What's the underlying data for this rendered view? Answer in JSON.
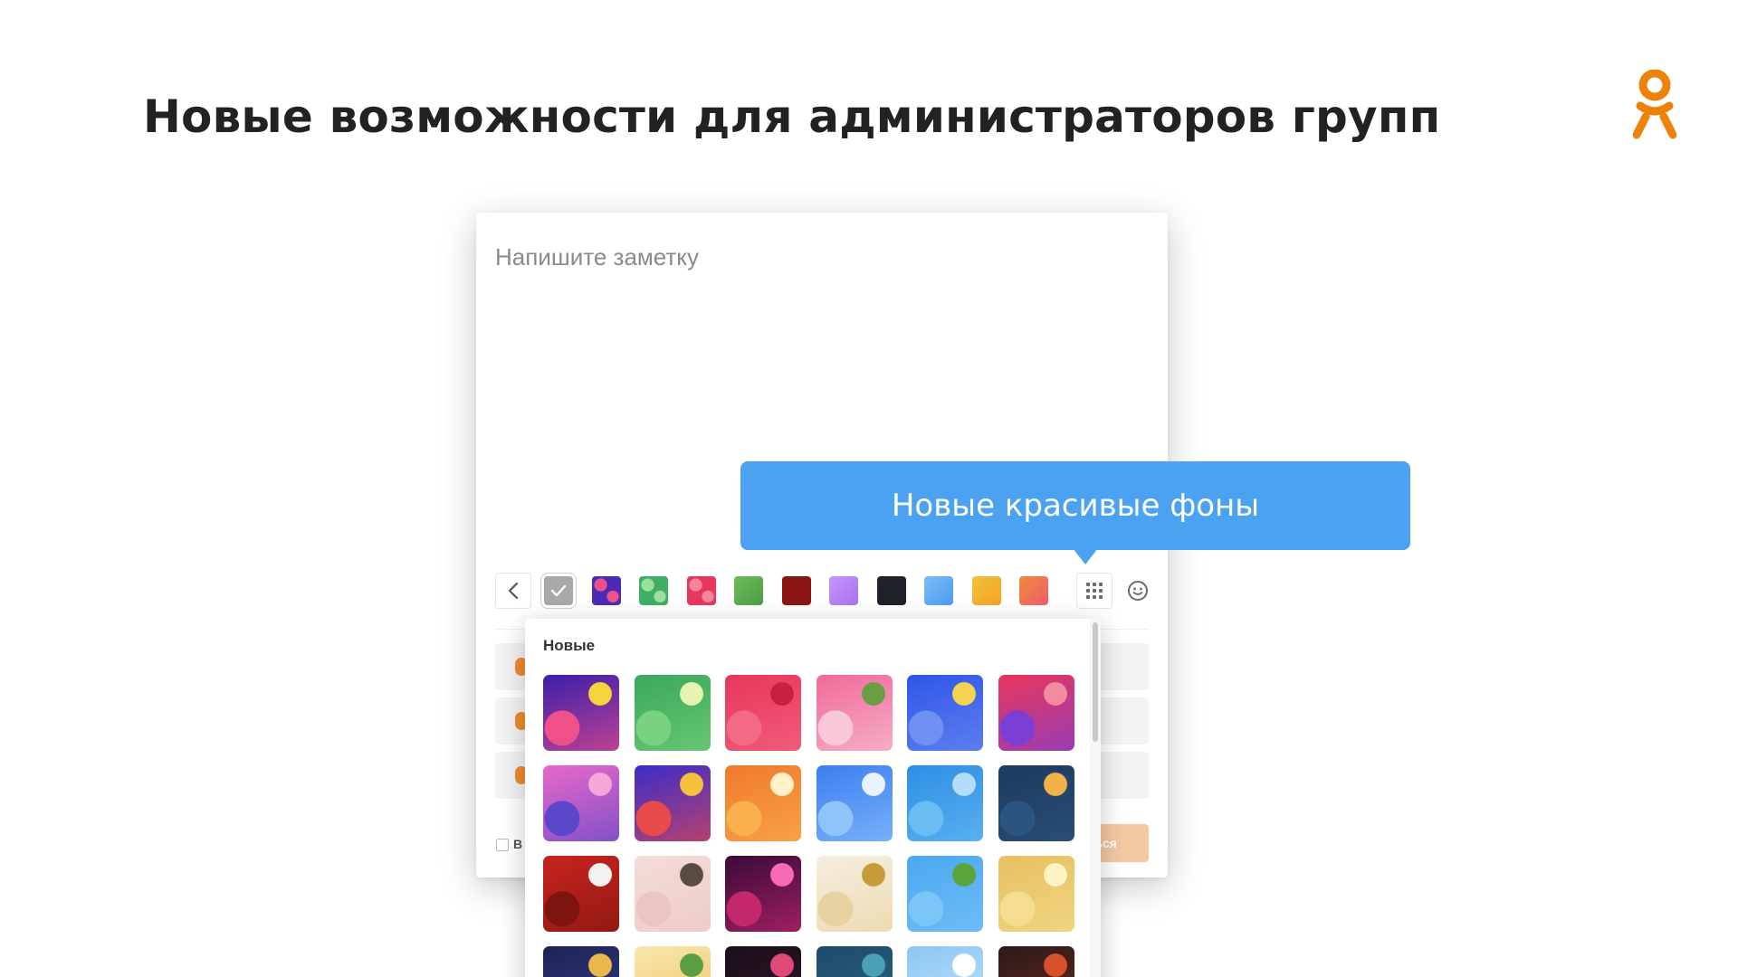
{
  "slide": {
    "title": "Новые возможности для администраторов групп",
    "logo": {
      "icon": "odnoklassniki-logo-icon",
      "color": "#ee8208"
    }
  },
  "editor": {
    "placeholder": "Напишите заметку",
    "toolbar": {
      "back_icon": "chevron-left-icon",
      "swatches": [
        {
          "name": "none",
          "color": "#a9a9a9",
          "selected": true
        },
        {
          "name": "party",
          "color": "#4b2bb6"
        },
        {
          "name": "money",
          "color": "#3fae66"
        },
        {
          "name": "hearts",
          "color": "#e8365c"
        },
        {
          "name": "green",
          "color": "#4e9e44"
        },
        {
          "name": "dark-red",
          "color": "#8a1513"
        },
        {
          "name": "purple",
          "color": "#a970f2"
        },
        {
          "name": "black",
          "color": "#1f2228"
        },
        {
          "name": "blue",
          "color": "#4a9cf2"
        },
        {
          "name": "orange",
          "color": "#f6a028"
        },
        {
          "name": "sunset",
          "color": "#ef5c6b"
        }
      ],
      "grid_icon": "grid-icon",
      "emoji_icon": "smile-icon"
    },
    "footer": {
      "checkbox_label": "В",
      "publish_label": "ься"
    }
  },
  "picker": {
    "heading": "Новые",
    "tiles": [
      {
        "name": "party-confetti",
        "colors": [
          "#3b1fa8",
          "#f0508a",
          "#f5d33b"
        ]
      },
      {
        "name": "money-bills",
        "colors": [
          "#3aa85b",
          "#79d27f",
          "#e5f5b0"
        ]
      },
      {
        "name": "red-hearts",
        "colors": [
          "#e8365c",
          "#f36a85",
          "#c8203f"
        ]
      },
      {
        "name": "sakura-flowers",
        "colors": [
          "#f06a9a",
          "#f8c7d8",
          "#6b9e43"
        ]
      },
      {
        "name": "night-clouds",
        "colors": [
          "#2f55e8",
          "#6f8ff2",
          "#f3d350"
        ]
      },
      {
        "name": "bubbles-red",
        "colors": [
          "#e8365c",
          "#7b3fd6",
          "#f28aa0"
        ]
      },
      {
        "name": "pink-hills",
        "colors": [
          "#e868c9",
          "#5a47c9",
          "#f4a7d8"
        ]
      },
      {
        "name": "ribbons-blue",
        "colors": [
          "#3b2cc9",
          "#e84a4a",
          "#f5c33b"
        ]
      },
      {
        "name": "oranges",
        "colors": [
          "#f07a2c",
          "#f9b14f",
          "#fff0c8"
        ]
      },
      {
        "name": "moon-sky",
        "colors": [
          "#3c7ef0",
          "#8fc4fb",
          "#e7f3ff"
        ]
      },
      {
        "name": "blue-gradient",
        "colors": [
          "#2d8fe3",
          "#6cbcf4",
          "#b4ddfa"
        ]
      },
      {
        "name": "starry-night",
        "colors": [
          "#1e3a5f",
          "#2b5580",
          "#f2b24a"
        ]
      },
      {
        "name": "theatre-curtain",
        "colors": [
          "#c7241d",
          "#7e1410",
          "#f2f2f2"
        ]
      },
      {
        "name": "cats-pastel",
        "colors": [
          "#f3dcd8",
          "#eac5c2",
          "#5a4a44"
        ]
      },
      {
        "name": "stage-lights",
        "colors": [
          "#3b0a3a",
          "#c4286b",
          "#f76bb6"
        ]
      },
      {
        "name": "golden-coins",
        "colors": [
          "#f5efe0",
          "#e8d2a0",
          "#c89a3a"
        ]
      },
      {
        "name": "green-branches",
        "colors": [
          "#4ba8f0",
          "#7cc5f7",
          "#5aa43a"
        ]
      },
      {
        "name": "gold-bokeh",
        "colors": [
          "#e7c060",
          "#f4dc90",
          "#fff2c4"
        ]
      },
      {
        "name": "navy-pattern",
        "colors": [
          "#1d2352",
          "#3c46a0",
          "#e8b84a"
        ]
      },
      {
        "name": "yellow-flowers",
        "colors": [
          "#f7e7b0",
          "#f0b43c",
          "#5a9e44"
        ]
      },
      {
        "name": "dark-sparkles",
        "colors": [
          "#1a0f1a",
          "#3b1a2c",
          "#e04a7a"
        ]
      },
      {
        "name": "teal-leaves",
        "colors": [
          "#1e4a6a",
          "#2e6e8c",
          "#4aa0b4"
        ]
      },
      {
        "name": "sky-clouds",
        "colors": [
          "#8cc7f4",
          "#d8ecfb",
          "#ffffff"
        ]
      },
      {
        "name": "dark-stripes",
        "colors": [
          "#2a1a1a",
          "#8a2c1f",
          "#d8502c"
        ]
      }
    ]
  },
  "tooltip": {
    "text": "Новые красивые фоны",
    "color": "#4aa2f0"
  }
}
